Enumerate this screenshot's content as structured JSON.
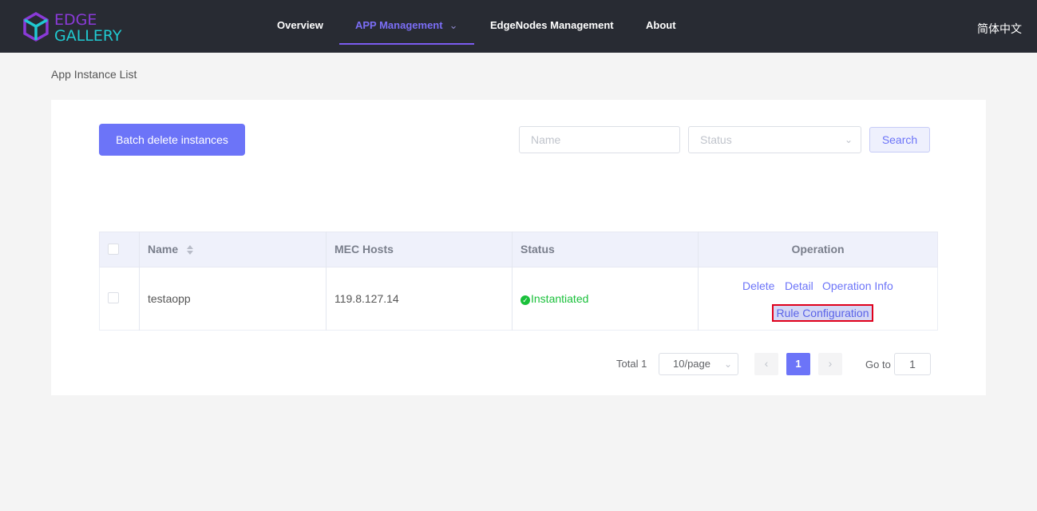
{
  "brand": {
    "line1": "EDGE",
    "line2": "GALLERY",
    "purple": "#8a3ad8",
    "cyan": "#20c9d0"
  },
  "nav": {
    "items": [
      {
        "label": "Overview"
      },
      {
        "label": "APP Management",
        "active": true
      },
      {
        "label": "EdgeNodes Management"
      },
      {
        "label": "About"
      }
    ],
    "language": "简体中文"
  },
  "page": {
    "title": "App Instance List"
  },
  "toolbar": {
    "batch_delete_label": "Batch delete instances",
    "name_placeholder": "Name",
    "status_placeholder": "Status",
    "search_label": "Search"
  },
  "table": {
    "headers": {
      "name": "Name",
      "mec_hosts": "MEC Hosts",
      "status": "Status",
      "operation": "Operation"
    },
    "rows": [
      {
        "name": "testaopp",
        "mec_host": "119.8.127.14",
        "status": "Instantiated",
        "ops": {
          "delete": "Delete",
          "detail": "Detail",
          "operation_info": "Operation Info",
          "rule_configuration": "Rule Configuration"
        }
      }
    ]
  },
  "pagination": {
    "total_label": "Total 1",
    "page_size": "10/page",
    "current_page": "1",
    "goto_label": "Go to",
    "goto_value": "1"
  },
  "colors": {
    "accent": "#6c74f8",
    "header_bg": "#282b33",
    "success": "#19c03a",
    "highlight_border": "#e0001b"
  }
}
